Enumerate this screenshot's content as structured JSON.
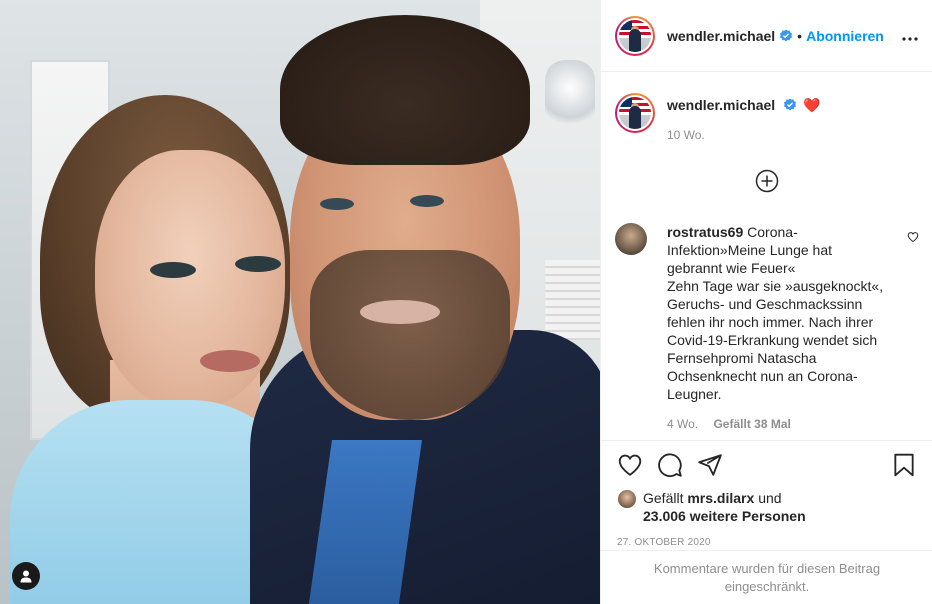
{
  "post": {
    "author": "wendler.michael",
    "follow_label": "Abonnieren",
    "separator": "•",
    "more_label": "•••"
  },
  "caption": {
    "author": "wendler.michael",
    "emoji": "❤️",
    "time": "10 Wo."
  },
  "comment": {
    "user": "rostratus69",
    "lines": [
      "Corona-",
      "Infektion»Meine Lunge hat",
      "gebrannt wie Feuer«",
      "Zehn Tage war sie »ausgeknockt«,",
      "Geruchs- und Geschmackssinn",
      "fehlen ihr noch immer. Nach ihrer",
      "Covid-19-Erkrankung wendet sich",
      "Fernsehpromi Natascha",
      "Ochsenknecht nun an Corona-",
      "Leugner."
    ],
    "time": "4 Wo.",
    "likes": "Gefällt 38 Mal"
  },
  "likes": {
    "prefix": "Gefällt",
    "user": "mrs.dilarx",
    "conj": "und",
    "count": "23.006 weitere Personen"
  },
  "date": "27. OKTOBER 2020",
  "restricted_text": "Kommentare wurden für diesen Beitrag eingeschränkt.",
  "colors": {
    "accent": "#0095f6",
    "heart": "#ed4956",
    "muted": "#8e8e8e"
  },
  "icons": [
    "user-tag-icon",
    "verified-icon",
    "more-icon",
    "add-comment-icon",
    "heart-icon",
    "comment-icon",
    "share-icon",
    "bookmark-icon"
  ]
}
